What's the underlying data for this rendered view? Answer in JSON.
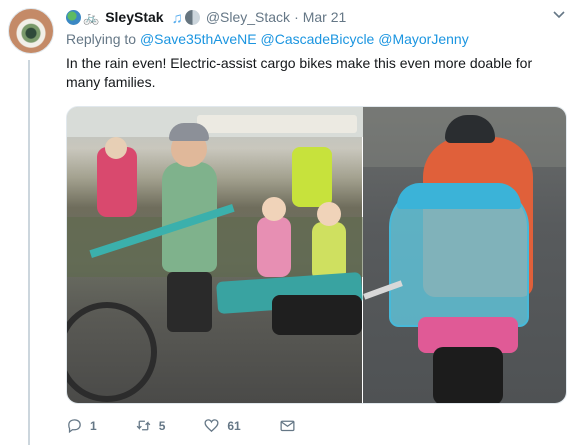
{
  "author": {
    "display_name": "SleyStak",
    "handle": "@Sley_Stack",
    "separator": "·",
    "timestamp": "Mar 21",
    "name_emoji": [
      "globe-icon",
      "bicycle-icon"
    ],
    "trailing_emoji": [
      "music-notes-icon",
      "moon-icon"
    ]
  },
  "reply": {
    "prefix": "Replying to",
    "mentions": [
      "@Save35thAveNE",
      "@CascadeBicycle",
      "@MayorJenny"
    ]
  },
  "text": "In the rain even! Electric-assist cargo bikes make this even more doable for many families.",
  "actions": {
    "reply_count": "1",
    "retweet_count": "5",
    "like_count": "61"
  },
  "colors": {
    "link": "#1b95e0",
    "secondary_text": "#657786",
    "thread_line": "#ccd6dd"
  }
}
